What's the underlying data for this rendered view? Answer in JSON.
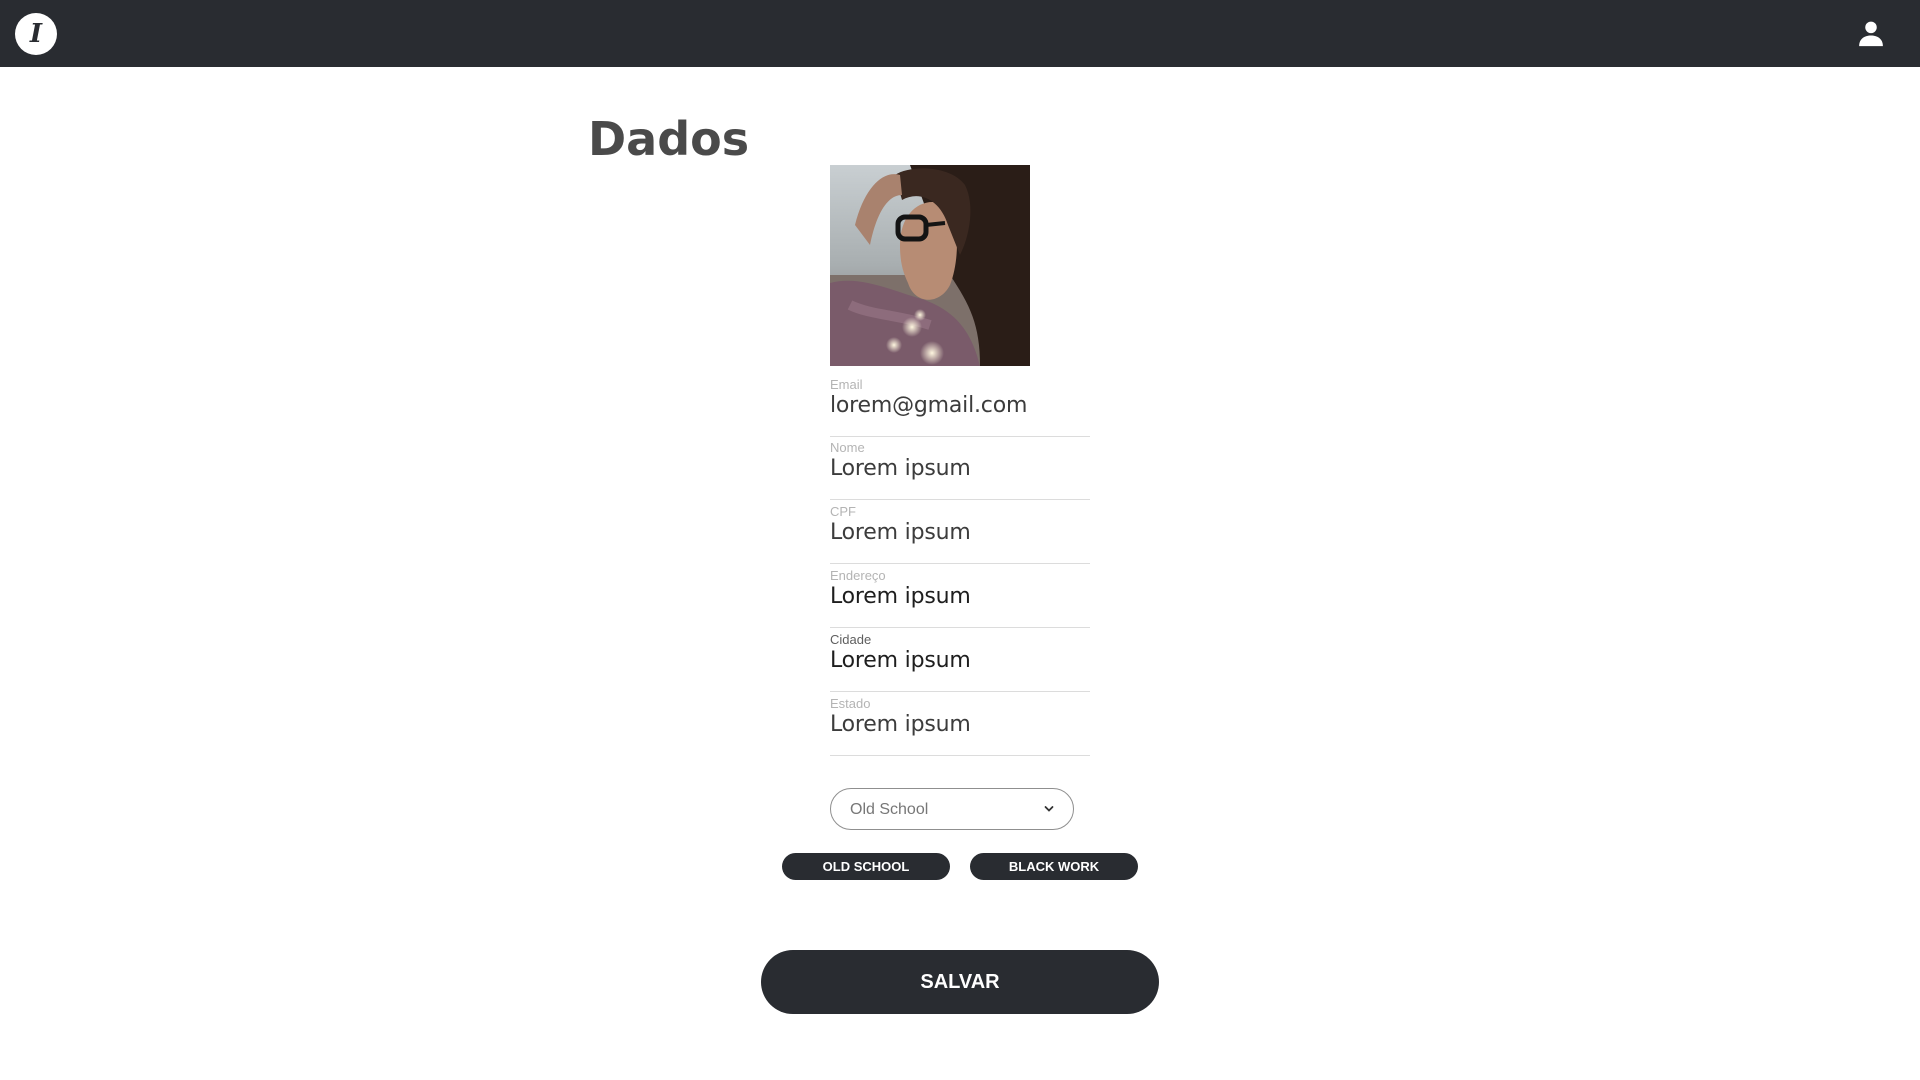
{
  "header": {
    "logo_glyph": "I",
    "logo_icon": "logo-icon",
    "user_icon": "user-icon"
  },
  "main": {
    "title": "Dados",
    "photo_icon": "profile-photo",
    "fields": [
      {
        "label": "Email",
        "value": "lorem@gmail.com"
      },
      {
        "label": "Nome",
        "value": "Lorem ipsum"
      },
      {
        "label": "CPF",
        "value": "Lorem ipsum"
      },
      {
        "label": "Endereço",
        "value": "Lorem ipsum"
      },
      {
        "label": "Cidade",
        "value": "Lorem ipsum"
      },
      {
        "label": "Estado",
        "value": "Lorem ipsum"
      }
    ],
    "style_select": {
      "selected": "Old School",
      "icon": "chevron-down-icon"
    },
    "tags": [
      "OLD SCHOOL",
      "BLACK WORK"
    ],
    "save_label": "SALVAR"
  },
  "colors": {
    "topbar": "#292c31",
    "button": "#292c31",
    "title": "#4a4a4a"
  }
}
